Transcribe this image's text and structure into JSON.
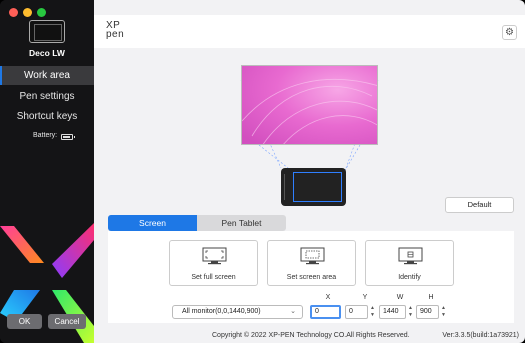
{
  "window": {
    "title": ""
  },
  "sidebar": {
    "device_name": "Deco LW",
    "nav": [
      {
        "label": "Work area",
        "active": true
      },
      {
        "label": "Pen settings",
        "active": false
      },
      {
        "label": "Shortcut keys",
        "active": false
      }
    ],
    "battery_label": "Battery:",
    "ok_label": "OK",
    "cancel_label": "Cancel"
  },
  "header": {
    "logo_line1": "XP",
    "logo_line2": "pen",
    "settings_icon": "gear-icon"
  },
  "workarea": {
    "default_label": "Default",
    "tabs": [
      {
        "label": "Screen",
        "active": true
      },
      {
        "label": "Pen Tablet",
        "active": false
      }
    ],
    "options": [
      {
        "label": "Set full screen",
        "icon": "full-screen-icon"
      },
      {
        "label": "Set screen area",
        "icon": "screen-area-icon"
      },
      {
        "label": "Identify",
        "icon": "identify-icon"
      }
    ],
    "monitor_select": "All monitor(0,0,1440,900)",
    "coords": {
      "x_label": "X",
      "y_label": "Y",
      "w_label": "W",
      "h_label": "H",
      "x": "0",
      "y": "0",
      "w": "1440",
      "h": "900"
    }
  },
  "footer": {
    "copyright": "Copyright © 2022  XP-PEN Technology CO.All Rights Reserved.",
    "version": "Ver:3.3.5(build:1a73921)"
  },
  "colors": {
    "accent": "#1e78e6",
    "sidebar_bg": "#141416",
    "preview_pink": "#e86ad0"
  }
}
